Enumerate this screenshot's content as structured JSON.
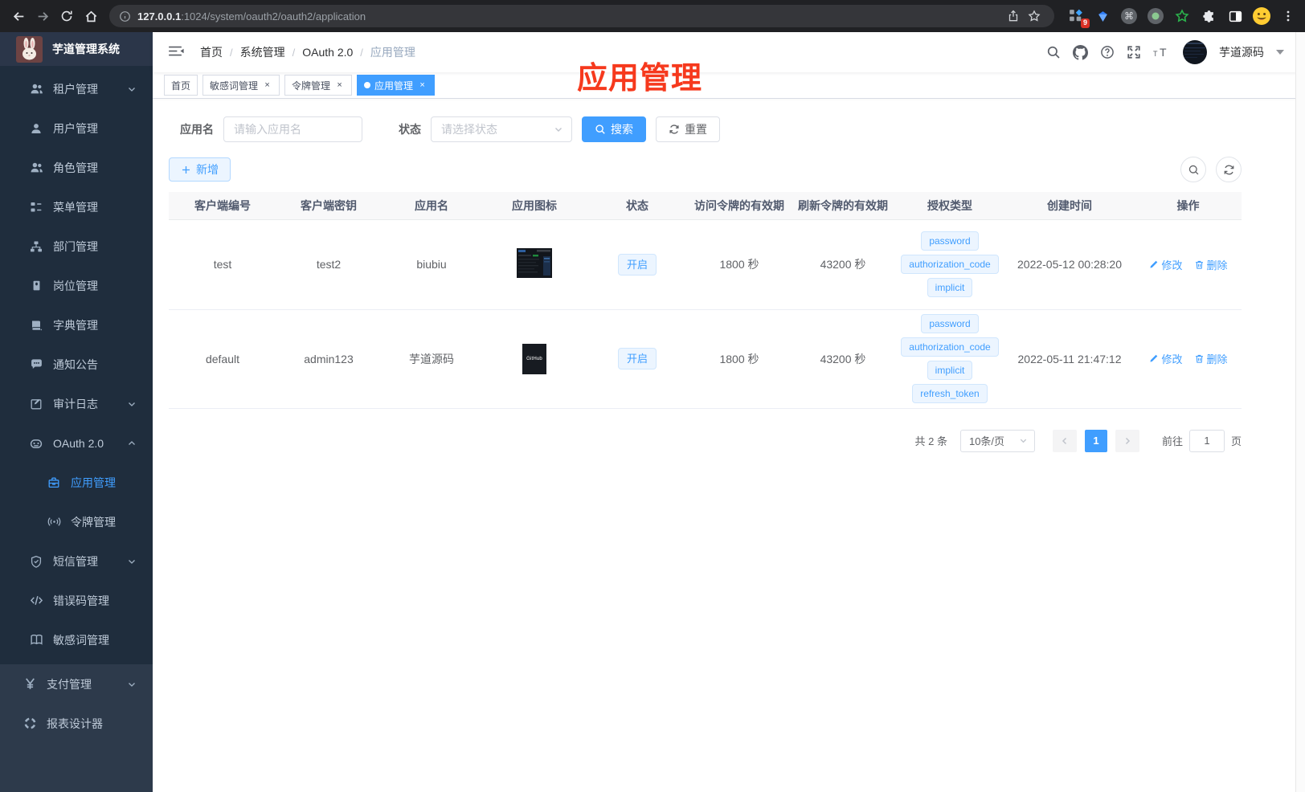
{
  "browser": {
    "url_host": "127.0.0.1",
    "url_rest": ":1024/system/oauth2/oauth2/application",
    "extension_badge": "9"
  },
  "sidebar": {
    "title": "芋道管理系统",
    "items": [
      {
        "key": "tenant",
        "label": "租户管理",
        "icon": "users",
        "chevron": "down",
        "level": 1,
        "section": "sub"
      },
      {
        "key": "user",
        "label": "用户管理",
        "icon": "user",
        "level": 1,
        "section": "sub"
      },
      {
        "key": "role",
        "label": "角色管理",
        "icon": "users",
        "level": 1,
        "section": "sub"
      },
      {
        "key": "menu",
        "label": "菜单管理",
        "icon": "menu-tree",
        "level": 1,
        "section": "sub"
      },
      {
        "key": "dept",
        "label": "部门管理",
        "icon": "org",
        "level": 1,
        "section": "sub"
      },
      {
        "key": "post",
        "label": "岗位管理",
        "icon": "badge",
        "level": 1,
        "section": "sub"
      },
      {
        "key": "dict",
        "label": "字典管理",
        "icon": "dict",
        "level": 1,
        "section": "sub"
      },
      {
        "key": "notice",
        "label": "通知公告",
        "icon": "notice",
        "level": 1,
        "section": "sub"
      },
      {
        "key": "audit-log",
        "label": "审计日志",
        "icon": "audit",
        "chevron": "down",
        "level": 1,
        "section": "sub"
      },
      {
        "key": "oauth2",
        "label": "OAuth 2.0",
        "icon": "oauth",
        "chevron": "up",
        "level": 1,
        "section": "sub"
      },
      {
        "key": "oauth2-application",
        "label": "应用管理",
        "icon": "app",
        "level": 2,
        "section": "sub",
        "active": true
      },
      {
        "key": "oauth2-token",
        "label": "令牌管理",
        "icon": "token",
        "level": 2,
        "section": "sub"
      },
      {
        "key": "sms",
        "label": "短信管理",
        "icon": "shield",
        "chevron": "down",
        "level": 1,
        "section": "sub"
      },
      {
        "key": "error-code",
        "label": "错误码管理",
        "icon": "code",
        "level": 1,
        "section": "sub"
      },
      {
        "key": "sensitive-word",
        "label": "敏感词管理",
        "icon": "open-book",
        "level": 1,
        "section": "sub"
      },
      {
        "key": "pay",
        "label": "支付管理",
        "icon": "yen",
        "chevron": "down",
        "level": 0,
        "section": "base"
      },
      {
        "key": "report-designer",
        "label": "报表设计器",
        "icon": "report",
        "level": 0,
        "section": "base"
      }
    ]
  },
  "navbar": {
    "breadcrumb": [
      "首页",
      "系统管理",
      "OAuth 2.0",
      "应用管理"
    ],
    "username": "芋道源码"
  },
  "annotation": {
    "text": "应用管理",
    "color": "#f6391d"
  },
  "tabs": [
    {
      "key": "home",
      "label": "首页",
      "closable": false,
      "active": false
    },
    {
      "key": "sensitive-word",
      "label": "敏感词管理",
      "closable": true,
      "active": false
    },
    {
      "key": "token",
      "label": "令牌管理",
      "closable": true,
      "active": false
    },
    {
      "key": "application",
      "label": "应用管理",
      "closable": true,
      "active": true
    }
  ],
  "filters": {
    "name_label": "应用名",
    "name_placeholder": "请输入应用名",
    "status_label": "状态",
    "status_placeholder": "请选择状态",
    "search_label": "搜索",
    "reset_label": "重置"
  },
  "toolbar": {
    "add_label": "新增"
  },
  "table": {
    "columns": [
      "客户端编号",
      "客户端密钥",
      "应用名",
      "应用图标",
      "状态",
      "访问令牌的有效期",
      "刷新令牌的有效期",
      "授权类型",
      "创建时间",
      "操作"
    ],
    "action_edit": "修改",
    "action_delete": "删除",
    "rows": [
      {
        "client_id": "test",
        "secret": "test2",
        "name": "biubiu",
        "icon_type": "screenshot",
        "icon_label": "",
        "status": "开启",
        "access_ttl": "1800 秒",
        "refresh_ttl": "43200 秒",
        "grants": [
          "password",
          "authorization_code",
          "implicit"
        ],
        "created": "2022-05-12 00:28:20"
      },
      {
        "client_id": "default",
        "secret": "admin123",
        "name": "芋道源码",
        "icon_type": "github",
        "icon_label": "GitHub",
        "status": "开启",
        "access_ttl": "1800 秒",
        "refresh_ttl": "43200 秒",
        "grants": [
          "password",
          "authorization_code",
          "implicit",
          "refresh_token"
        ],
        "created": "2022-05-11 21:47:12"
      }
    ]
  },
  "pagination": {
    "total_label": "共 2 条",
    "page_size": "10条/页",
    "current_page": "1",
    "jump_prefix": "前往",
    "jump_value": "1",
    "jump_suffix": "页"
  },
  "colors": {
    "accent": "#409eff",
    "sidebar_bg": "#2d3a4b",
    "sidebar_sub_bg": "#1f2d3d",
    "tag_bg": "#ecf5ff"
  }
}
